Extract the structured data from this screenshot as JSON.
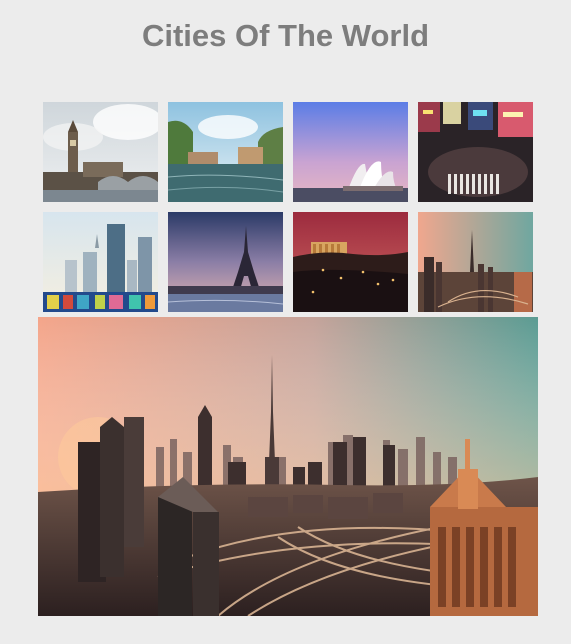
{
  "page": {
    "title": "Cities Of The World"
  },
  "gallery": {
    "thumbnails": [
      {
        "subject": "london-big-ben",
        "selected": false
      },
      {
        "subject": "amsterdam-canal",
        "selected": false
      },
      {
        "subject": "sydney-opera-house",
        "selected": false
      },
      {
        "subject": "tokyo-shibuya-crossing",
        "selected": false
      },
      {
        "subject": "berlin-skyline",
        "selected": false
      },
      {
        "subject": "paris-eiffel-tower",
        "selected": false
      },
      {
        "subject": "athens-acropolis",
        "selected": false
      },
      {
        "subject": "dubai-skyline",
        "selected": true
      }
    ],
    "preview": {
      "subject": "dubai-skyline"
    }
  }
}
